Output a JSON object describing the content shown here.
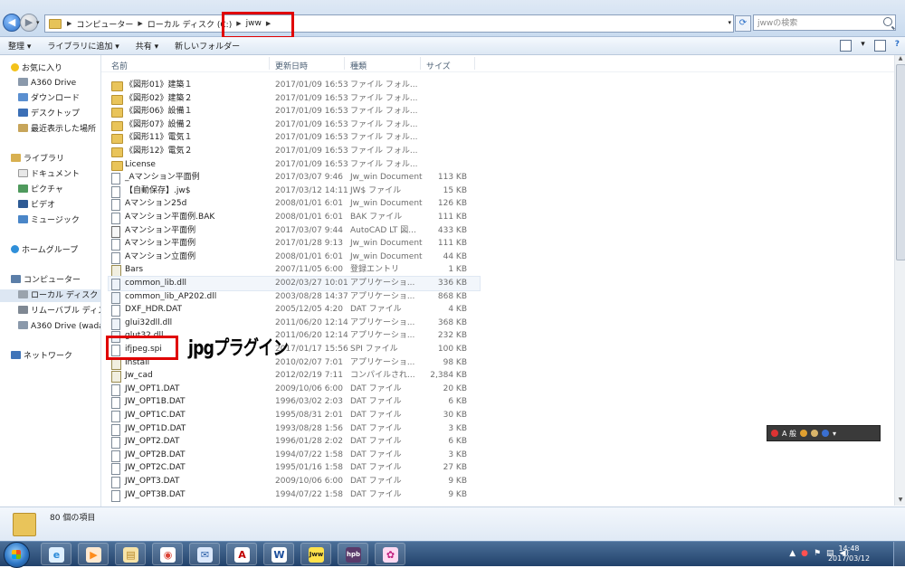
{
  "address": {
    "crumbs": [
      "コンピューター",
      "ローカル ディスク (C:)",
      "jww"
    ],
    "search_placeholder": "jwwの検索"
  },
  "toolbar": {
    "items": [
      "整理 ▾",
      "ライブラリに追加 ▾",
      "共有 ▾",
      "新しいフォルダー"
    ]
  },
  "sidebar": {
    "items": [
      {
        "label": "お気に入り",
        "icon": "star-icon"
      },
      {
        "label": "A360 Drive",
        "icon": "cloud-drive-icon"
      },
      {
        "label": "ダウンロード",
        "icon": "download-folder-icon"
      },
      {
        "label": "デスクトップ",
        "icon": "desktop-icon"
      },
      {
        "label": "最近表示した場所",
        "icon": "recent-places-icon"
      },
      {
        "label": "ライブラリ",
        "icon": "libraries-icon"
      },
      {
        "label": "ドキュメント",
        "icon": "documents-icon"
      },
      {
        "label": "ピクチャ",
        "icon": "pictures-icon"
      },
      {
        "label": "ビデオ",
        "icon": "videos-icon"
      },
      {
        "label": "ミュージック",
        "icon": "music-icon"
      },
      {
        "label": "ホームグループ",
        "icon": "homegroup-icon"
      },
      {
        "label": "コンピューター",
        "icon": "computer-icon"
      },
      {
        "label": "ローカル ディスク (",
        "icon": "local-disk-icon"
      },
      {
        "label": "リムーバブル ディス",
        "icon": "removable-disk-icon"
      },
      {
        "label": "A360 Drive (wada)",
        "icon": "cloud-drive-icon"
      },
      {
        "label": "ネットワーク",
        "icon": "network-icon"
      }
    ]
  },
  "columns": {
    "name": "名前",
    "date": "更新日時",
    "type": "種類",
    "size": "サイズ"
  },
  "files": [
    {
      "name": "《図形01》建築１",
      "date": "2017/01/09 16:53",
      "type": "ファイル フォル...",
      "size": "",
      "kind": "folder"
    },
    {
      "name": "《図形02》建築２",
      "date": "2017/01/09 16:53",
      "type": "ファイル フォル...",
      "size": "",
      "kind": "folder"
    },
    {
      "name": "《図形06》設備１",
      "date": "2017/01/09 16:53",
      "type": "ファイル フォル...",
      "size": "",
      "kind": "folder"
    },
    {
      "name": "《図形07》設備２",
      "date": "2017/01/09 16:53",
      "type": "ファイル フォル...",
      "size": "",
      "kind": "folder"
    },
    {
      "name": "《図形11》電気１",
      "date": "2017/01/09 16:53",
      "type": "ファイル フォル...",
      "size": "",
      "kind": "folder"
    },
    {
      "name": "《図形12》電気２",
      "date": "2017/01/09 16:53",
      "type": "ファイル フォル...",
      "size": "",
      "kind": "folder"
    },
    {
      "name": "License",
      "date": "2017/01/09 16:53",
      "type": "ファイル フォル...",
      "size": "",
      "kind": "folder"
    },
    {
      "name": "_Aマンション平面例",
      "date": "2017/03/07 9:46",
      "type": "Jw_win Document",
      "size": "113 KB",
      "kind": "doc"
    },
    {
      "name": "【自動保存】.jw$",
      "date": "2017/03/12 14:11",
      "type": "JW$ ファイル",
      "size": "15 KB",
      "kind": "doc"
    },
    {
      "name": "Aマンション25d",
      "date": "2008/01/01 6:01",
      "type": "Jw_win Document",
      "size": "126 KB",
      "kind": "doc"
    },
    {
      "name": "Aマンション平面例.BAK",
      "date": "2008/01/01 6:01",
      "type": "BAK ファイル",
      "size": "111 KB",
      "kind": "doc"
    },
    {
      "name": "Aマンション平面例",
      "date": "2017/03/07 9:44",
      "type": "AutoCAD LT 図...",
      "size": "433 KB",
      "kind": "dwg"
    },
    {
      "name": "Aマンション平面例",
      "date": "2017/01/28 9:13",
      "type": "Jw_win Document",
      "size": "111 KB",
      "kind": "doc"
    },
    {
      "name": "Aマンション立面例",
      "date": "2008/01/01 6:01",
      "type": "Jw_win Document",
      "size": "44 KB",
      "kind": "doc"
    },
    {
      "name": "Bars",
      "date": "2007/11/05 6:00",
      "type": "登録エントリ",
      "size": "1 KB",
      "kind": "exe"
    },
    {
      "name": "common_lib.dll",
      "date": "2002/03/27 10:01",
      "type": "アプリケーショ...",
      "size": "336 KB",
      "kind": "dll"
    },
    {
      "name": "common_lib_AP202.dll",
      "date": "2003/08/28 14:37",
      "type": "アプリケーショ...",
      "size": "868 KB",
      "kind": "dll"
    },
    {
      "name": "DXF_HDR.DAT",
      "date": "2005/12/05 4:20",
      "type": "DAT ファイル",
      "size": "4 KB",
      "kind": "doc"
    },
    {
      "name": "glui32dll.dll",
      "date": "2011/06/20 12:14",
      "type": "アプリケーショ...",
      "size": "368 KB",
      "kind": "dll"
    },
    {
      "name": "glut32.dll",
      "date": "2011/06/20 12:14",
      "type": "アプリケーショ...",
      "size": "232 KB",
      "kind": "dll"
    },
    {
      "name": "ifjpeg.spi",
      "date": "2017/01/17 15:56",
      "type": "SPI ファイル",
      "size": "100 KB",
      "kind": "doc"
    },
    {
      "name": "Install",
      "date": "2010/02/07 7:01",
      "type": "アプリケーショ...",
      "size": "98 KB",
      "kind": "exe"
    },
    {
      "name": "Jw_cad",
      "date": "2012/02/19 7:11",
      "type": "コンパイルされ...",
      "size": "2,384 KB",
      "kind": "exe"
    },
    {
      "name": "JW_OPT1.DAT",
      "date": "2009/10/06 6:00",
      "type": "DAT ファイル",
      "size": "20 KB",
      "kind": "doc"
    },
    {
      "name": "JW_OPT1B.DAT",
      "date": "1996/03/02 2:03",
      "type": "DAT ファイル",
      "size": "6 KB",
      "kind": "doc"
    },
    {
      "name": "JW_OPT1C.DAT",
      "date": "1995/08/31 2:01",
      "type": "DAT ファイル",
      "size": "30 KB",
      "kind": "doc"
    },
    {
      "name": "JW_OPT1D.DAT",
      "date": "1993/08/28 1:56",
      "type": "DAT ファイル",
      "size": "3 KB",
      "kind": "doc"
    },
    {
      "name": "JW_OPT2.DAT",
      "date": "1996/01/28 2:02",
      "type": "DAT ファイル",
      "size": "6 KB",
      "kind": "doc"
    },
    {
      "name": "JW_OPT2B.DAT",
      "date": "1994/07/22 1:58",
      "type": "DAT ファイル",
      "size": "3 KB",
      "kind": "doc"
    },
    {
      "name": "JW_OPT2C.DAT",
      "date": "1995/01/16 1:58",
      "type": "DAT ファイル",
      "size": "27 KB",
      "kind": "doc"
    },
    {
      "name": "JW_OPT3.DAT",
      "date": "2009/10/06 6:00",
      "type": "DAT ファイル",
      "size": "9 KB",
      "kind": "doc"
    },
    {
      "name": "JW_OPT3B.DAT",
      "date": "1994/07/22 1:58",
      "type": "DAT ファイル",
      "size": "9 KB",
      "kind": "doc"
    }
  ],
  "annotation": {
    "text": "jpgプラグイン",
    "color": "#e00000"
  },
  "ime_bar": {
    "text": "A 般"
  },
  "status": {
    "count": "80 個の項目"
  },
  "taskbar": {
    "apps": [
      {
        "name": "ie",
        "glyph": "e",
        "color": "#2a8ad8",
        "bg": "#dff0ff"
      },
      {
        "name": "media-player",
        "glyph": "▶",
        "color": "#ff8c1a",
        "bg": "#ffe9cf"
      },
      {
        "name": "explorer",
        "glyph": "▤",
        "color": "#b88a2a",
        "bg": "#f7e3a7"
      },
      {
        "name": "chrome",
        "glyph": "◉",
        "color": "#db4437",
        "bg": "#fff"
      },
      {
        "name": "thunderbird",
        "glyph": "✉",
        "color": "#2c5fa8",
        "bg": "#dbe8fb"
      },
      {
        "name": "autocad",
        "glyph": "A",
        "color": "#c00000",
        "bg": "#ffffff"
      },
      {
        "name": "word",
        "glyph": "W",
        "color": "#1c4f9c",
        "bg": "#ffffff"
      },
      {
        "name": "jww",
        "glyph": "Jww",
        "color": "#1a1a1a",
        "bg": "#ffe14a"
      },
      {
        "name": "hpb",
        "glyph": "hpb",
        "color": "#ffffff",
        "bg": "#5a3a6a"
      },
      {
        "name": "paint",
        "glyph": "✿",
        "color": "#c02080",
        "bg": "#ffd9f2"
      }
    ],
    "time": "14:48",
    "date": "2017/03/12"
  }
}
